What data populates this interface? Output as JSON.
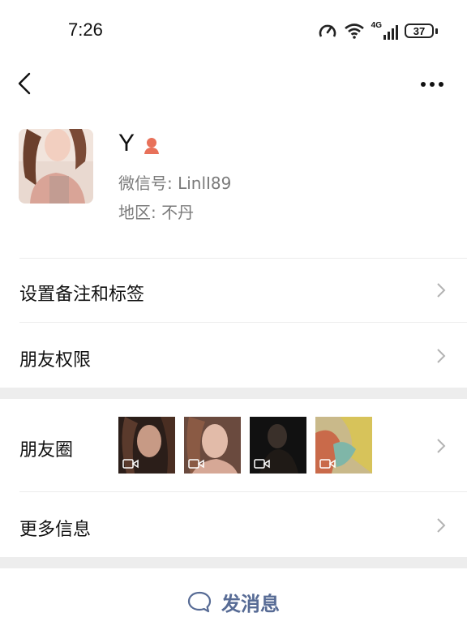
{
  "status_bar": {
    "time": "7:26",
    "network": "4G",
    "battery": "37"
  },
  "profile": {
    "name": "Y",
    "wechat_id": "微信号: LinlI89",
    "region": "地区: 不丹"
  },
  "menu": {
    "remarks_tags": "设置备注和标签",
    "friend_permissions": "朋友权限",
    "moments": "朋友圈",
    "more_info": "更多信息"
  },
  "actions": {
    "send_message": "发消息"
  },
  "colors": {
    "link_blue": "#576b95",
    "section_gap": "#ededed",
    "verify_icon": "#e8715a"
  }
}
